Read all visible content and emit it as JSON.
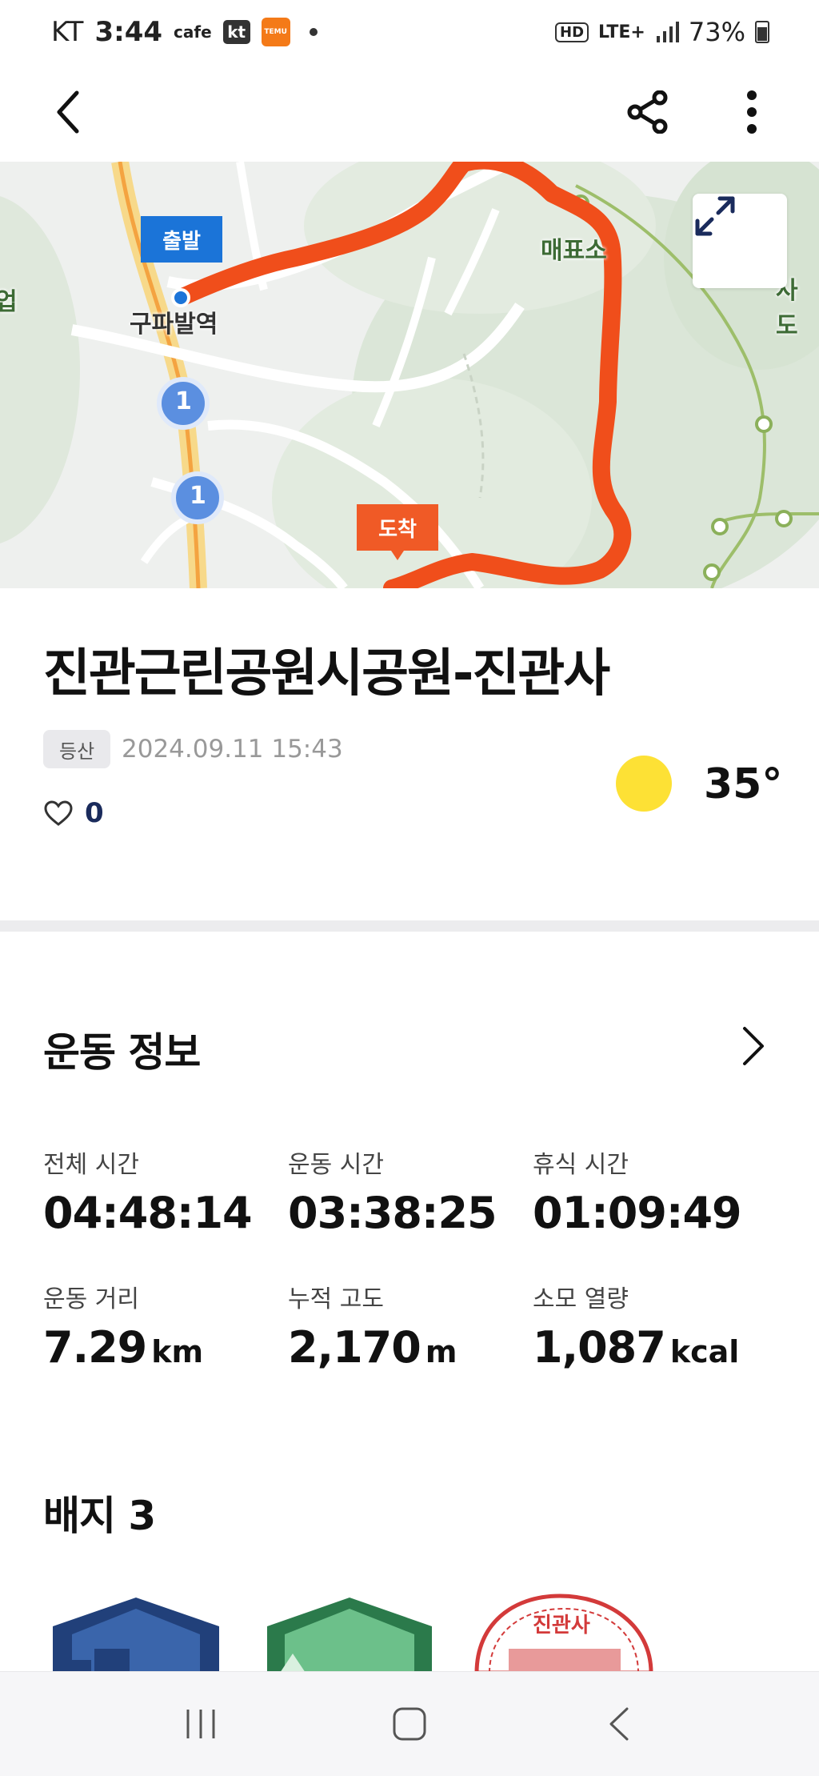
{
  "status_bar": {
    "carrier": "KT",
    "time": "3:44",
    "cafe": "cafe",
    "kt_badge": "kt",
    "temu_badge": "TEMU",
    "hd": "HD",
    "network": "LTE+",
    "battery": "73%"
  },
  "app_bar": {
    "back_icon": "chevron-left-icon",
    "share_icon": "share-icon",
    "more_icon": "more-vertical-icon"
  },
  "map": {
    "start_label": "출발",
    "end_label": "도착",
    "station_label": "구파발역",
    "place_label_1": "매표소",
    "place_label_2": "사도",
    "place_label_3": "업",
    "road_marker_1": "1",
    "road_marker_2": "1",
    "route_color": "#f04e1b",
    "expand_icon": "expand-icon"
  },
  "activity": {
    "title": "진관근린공원시공원-진관사",
    "category": "등산",
    "datetime": "2024.09.11 15:43",
    "likes": "0",
    "weather_icon": "sun-icon",
    "temperature": "35°"
  },
  "exercise_info": {
    "title": "운동 정보",
    "stats": [
      {
        "label": "전체 시간",
        "value": "04:48:14",
        "unit": ""
      },
      {
        "label": "운동 시간",
        "value": "03:38:25",
        "unit": ""
      },
      {
        "label": "휴식 시간",
        "value": "01:09:49",
        "unit": ""
      },
      {
        "label": "운동 거리",
        "value": "7.29",
        "unit": "km"
      },
      {
        "label": "누적 고도",
        "value": "2,170",
        "unit": "m"
      },
      {
        "label": "소모 열량",
        "value": "1,087",
        "unit": "kcal"
      }
    ]
  },
  "badges": {
    "title": "배지 3",
    "stamp_text": "진관사"
  },
  "nav": {
    "recents_icon": "recents-icon",
    "home_icon": "home-icon",
    "back_icon": "back-icon"
  }
}
